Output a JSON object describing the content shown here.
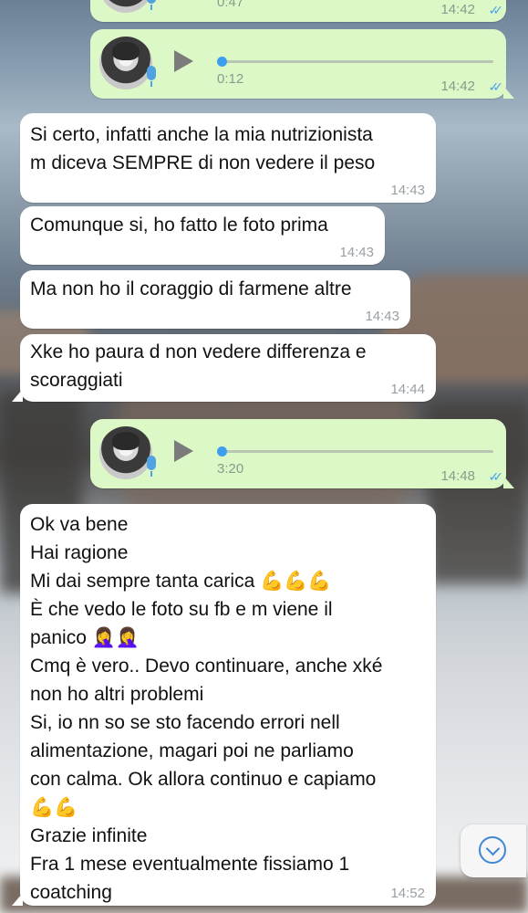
{
  "messages": [
    {
      "type": "voice",
      "direction": "out",
      "duration": "0:47",
      "time": "14:42",
      "status": "read"
    },
    {
      "type": "voice",
      "direction": "out",
      "duration": "0:12",
      "time": "14:42",
      "status": "read"
    },
    {
      "type": "text",
      "direction": "in",
      "text": "Si certo, infatti anche la mia nutrizionista\nm diceva SEMPRE di non vedere il peso",
      "time": "14:43"
    },
    {
      "type": "text",
      "direction": "in",
      "text": "Comunque si, ho fatto le foto prima",
      "time": "14:43"
    },
    {
      "type": "text",
      "direction": "in",
      "text": "Ma non ho il coraggio di farmene altre",
      "time": "14:43"
    },
    {
      "type": "text",
      "direction": "in",
      "text": "Xke ho paura d non vedere differenza e\nscoraggiati",
      "time": "14:44"
    },
    {
      "type": "voice",
      "direction": "out",
      "duration": "3:20",
      "time": "14:48",
      "status": "read"
    },
    {
      "type": "text",
      "direction": "in",
      "text": "Ok va bene\nHai ragione\nMi dai sempre tanta carica 💪💪💪\nÈ che vedo le foto su fb e m viene il\npanico 🤦‍♀️🤦‍♀️\nCmq è vero.. Devo continuare, anche xké\nnon ho altri problemi\nSi, io nn so se sto facendo errori nell\nalimentazione, magari poi ne parliamo\ncon calma. Ok allora continuo e capiamo\n💪💪\nGrazie infinite\nFra 1 mese eventualmente fissiamo 1\ncoatching",
      "time": "14:52"
    }
  ],
  "icons": {
    "voice_play": "play-icon",
    "mic": "microphone-icon",
    "read_receipt": "double-check-icon",
    "scroll_down": "chevron-down-icon"
  },
  "colors": {
    "incoming_bubble": "#ffffff",
    "outgoing_bubble": "#dcf8c6",
    "read_ticks": "#4aa3f0",
    "voice_progress": "#3d9ef0"
  }
}
